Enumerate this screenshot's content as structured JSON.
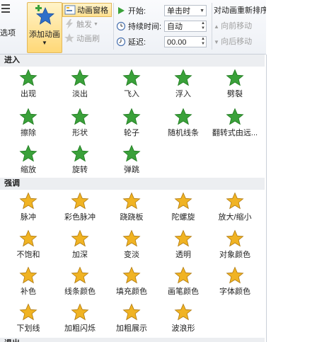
{
  "ribbon": {
    "left_fragment_label": "选项",
    "add_animation_label": "添加动画",
    "add_animation_arrow": "▼",
    "animation_pane_label": "动画窗格",
    "trigger_label": "触发",
    "painter_label": "动画刷",
    "start_label": "开始:",
    "start_value": "单击时",
    "duration_label": "持续时间:",
    "duration_value": "自动",
    "delay_label": "延迟:",
    "delay_value": "00.00",
    "reorder_title": "对动画重新排序",
    "move_earlier_label": "向前移动",
    "move_later_label": "向后移动"
  },
  "gallery": {
    "sections": [
      {
        "title": "进入",
        "color": "#3aa13a",
        "items": [
          "出现",
          "淡出",
          "飞入",
          "浮入",
          "劈裂",
          "擦除",
          "形状",
          "轮子",
          "随机线条",
          "翻转式由远...",
          "缩放",
          "旋转",
          "弹跳"
        ]
      },
      {
        "title": "强调",
        "color": "#f0b323",
        "items": [
          "脉冲",
          "彩色脉冲",
          "跷跷板",
          "陀螺旋",
          "放大/缩小",
          "不饱和",
          "加深",
          "变淡",
          "透明",
          "对象颜色",
          "补色",
          "线条颜色",
          "填充颜色",
          "画笔颜色",
          "字体颜色",
          "下划线",
          "加粗闪烁",
          "加粗展示",
          "波浪形"
        ]
      },
      {
        "title": "退出"
      }
    ]
  }
}
